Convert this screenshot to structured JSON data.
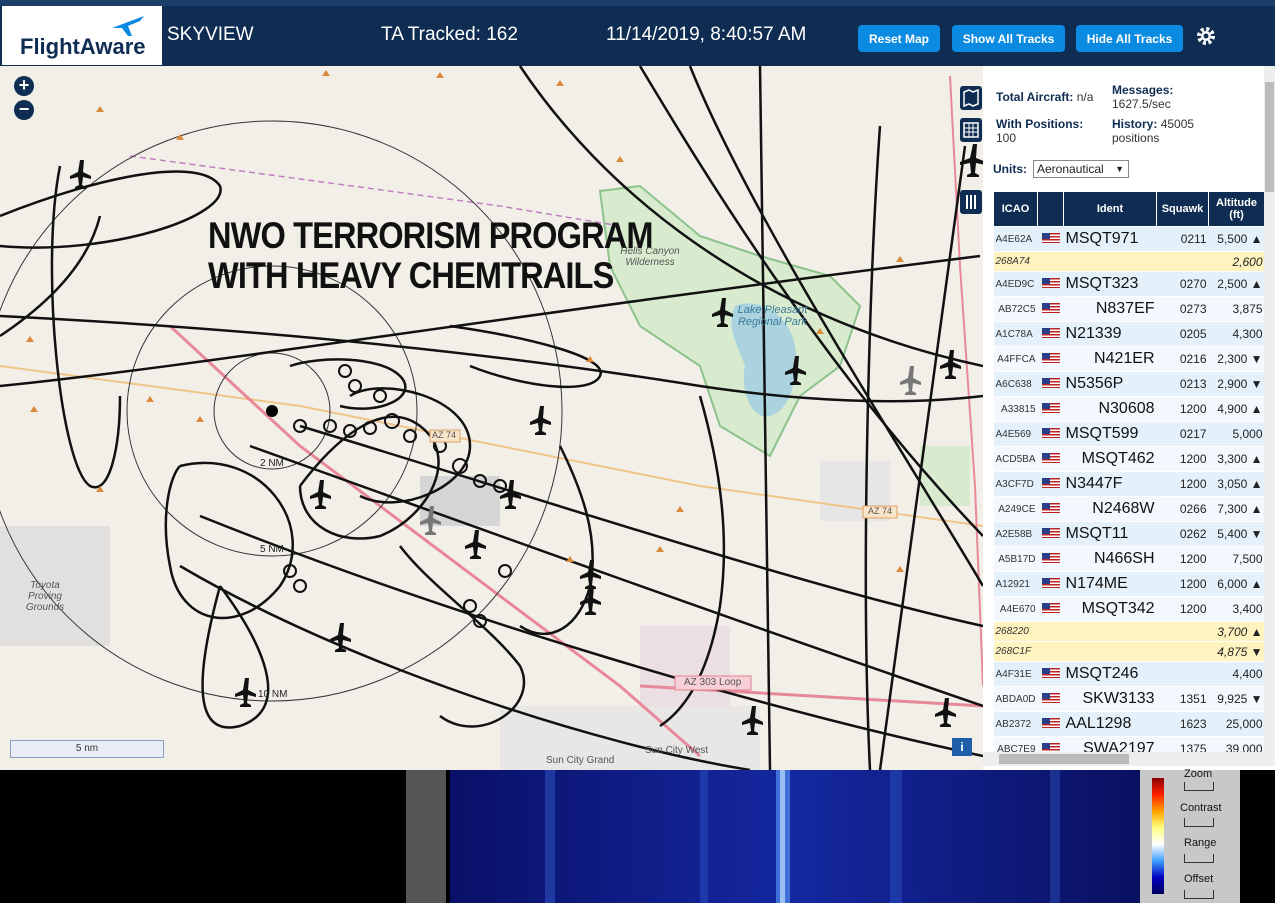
{
  "header": {
    "logo_text": "FlightAware",
    "app_name": "SKYVIEW",
    "tracked": "TA Tracked: 162",
    "datetime": "11/14/2019, 8:40:57 AM",
    "buttons": {
      "reset": "Reset Map",
      "show": "Show All Tracks",
      "hide": "Hide All Tracks"
    },
    "settings_icon": "gear-icon"
  },
  "map": {
    "overlay_line1": "NWO TERRORISM PROGRAM",
    "overlay_line2": "WITH HEAVY CHEMTRAILS",
    "labels": {
      "wilderness": "Hells Canyon Wilderness",
      "lake": "Lake Pleasant Regional Park",
      "az74a": "AZ 74",
      "az74b": "AZ 74",
      "az303": "AZ 303 Loop",
      "toyota": "Toyota Proving Grounds",
      "suncity": "Sun City West",
      "suncitygrand": "Sun City Grand",
      "ring2": "2 NM",
      "ring5": "5 NM",
      "ring10": "10 NM"
    },
    "scale_label": "5 nm",
    "zoom_in": "+",
    "zoom_out": "−",
    "info": "i"
  },
  "panel": {
    "total_label": "Total Aircraft:",
    "total_value": "n/a",
    "messages_label": "Messages:",
    "messages_value": "1627.5/sec",
    "positions_label": "With Positions:",
    "positions_value": "100",
    "history_label": "History:",
    "history_value": "45005 positions",
    "units_label": "Units:",
    "units_value": "Aeronautical",
    "columns": [
      "ICAO",
      "",
      "Ident",
      "Squawk",
      "Altitude (ft)"
    ],
    "rows": [
      {
        "icao": "A4E62A",
        "ident": "MSQT971",
        "squawk": "0211",
        "alt": "5,500 ▲",
        "type": "row"
      },
      {
        "icao": "268A74",
        "ident": "",
        "squawk": "",
        "alt": "2,600",
        "type": "yel"
      },
      {
        "icao": "A4ED9C",
        "ident": "MSQT323",
        "squawk": "0270",
        "alt": "2,500 ▲",
        "type": "row"
      },
      {
        "icao": "AB72C5",
        "ident": "N837EF",
        "squawk": "0273",
        "alt": "3,875",
        "type": "row"
      },
      {
        "icao": "A1C78A",
        "ident": "N21339",
        "squawk": "0205",
        "alt": "4,300",
        "type": "row"
      },
      {
        "icao": "A4FFCA",
        "ident": "N421ER",
        "squawk": "0216",
        "alt": "2,300 ▼",
        "type": "row"
      },
      {
        "icao": "A6C638",
        "ident": "N5356P",
        "squawk": "0213",
        "alt": "2,900 ▼",
        "type": "row"
      },
      {
        "icao": "A33815",
        "ident": "N30608",
        "squawk": "1200",
        "alt": "4,900 ▲",
        "type": "row"
      },
      {
        "icao": "A4E569",
        "ident": "MSQT599",
        "squawk": "0217",
        "alt": "5,000",
        "type": "row"
      },
      {
        "icao": "ACD5BA",
        "ident": "MSQT462",
        "squawk": "1200",
        "alt": "3,300 ▲",
        "type": "row"
      },
      {
        "icao": "A3CF7D",
        "ident": "N3447F",
        "squawk": "1200",
        "alt": "3,050 ▲",
        "type": "row"
      },
      {
        "icao": "A249CE",
        "ident": "N2468W",
        "squawk": "0266",
        "alt": "7,300 ▲",
        "type": "row"
      },
      {
        "icao": "A2E58B",
        "ident": "MSQT11",
        "squawk": "0262",
        "alt": "5,400 ▼",
        "type": "row"
      },
      {
        "icao": "A5B17D",
        "ident": "N466SH",
        "squawk": "1200",
        "alt": "7,500",
        "type": "row"
      },
      {
        "icao": "A12921",
        "ident": "N174ME",
        "squawk": "1200",
        "alt": "6,000 ▲",
        "type": "row"
      },
      {
        "icao": "A4E670",
        "ident": "MSQT342",
        "squawk": "1200",
        "alt": "3,400",
        "type": "row"
      },
      {
        "icao": "268220",
        "ident": "",
        "squawk": "",
        "alt": "3,700 ▲",
        "type": "yel"
      },
      {
        "icao": "268C1F",
        "ident": "",
        "squawk": "",
        "alt": "4,875 ▼",
        "type": "yel"
      },
      {
        "icao": "A4F31E",
        "ident": "MSQT246",
        "squawk": "",
        "alt": "4,400",
        "type": "row"
      },
      {
        "icao": "ABDA0D",
        "ident": "SKW3133",
        "squawk": "1351",
        "alt": "9,925 ▼",
        "type": "row"
      },
      {
        "icao": "AB2372",
        "ident": "AAL1298",
        "squawk": "1623",
        "alt": "25,000",
        "type": "row"
      },
      {
        "icao": "ABC7E9",
        "ident": "SWA2197",
        "squawk": "1375",
        "alt": "39,000",
        "type": "row"
      }
    ]
  },
  "waterfall": {
    "zoom": "Zoom",
    "contrast": "Contrast",
    "range": "Range",
    "offset": "Offset"
  }
}
